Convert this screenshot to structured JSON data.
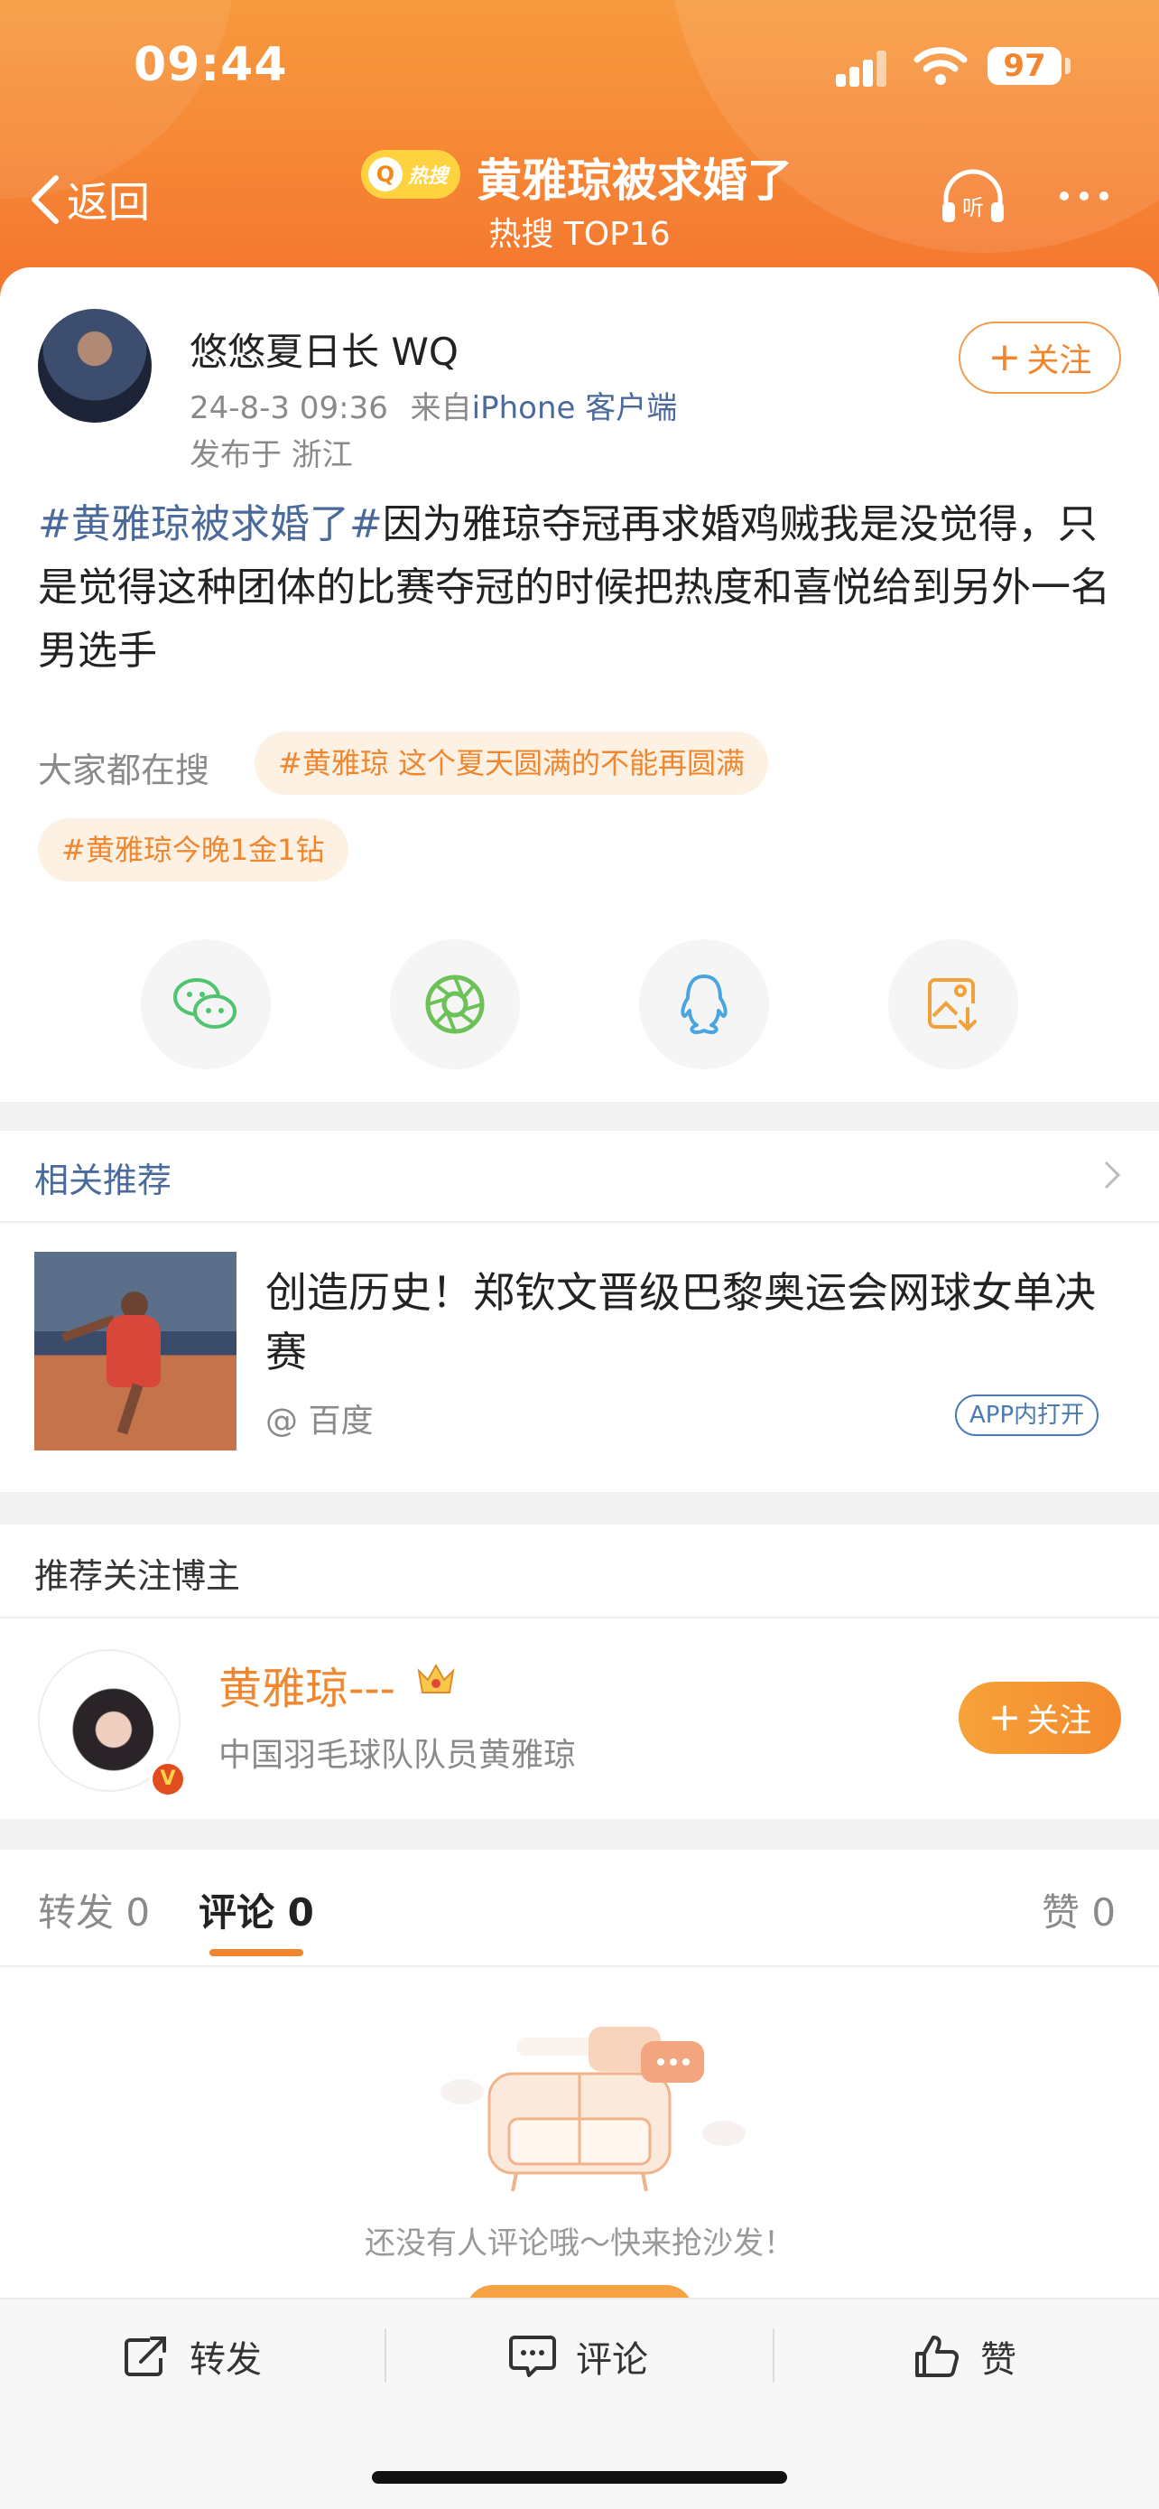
{
  "status_bar": {
    "time": "09:44",
    "battery": "97"
  },
  "nav": {
    "back_label": "返回",
    "hot_badge": "热搜",
    "title": "黄雅琼被求婚了",
    "subtitle": "热搜 TOP16"
  },
  "post": {
    "author": "悠悠夏日长 WQ",
    "date": "24-8-3 09:36",
    "source_prefix": "来自",
    "source": "iPhone 客户端",
    "location": "发布于 浙江",
    "follow_label": "关注",
    "tag": "#黄雅琼被求婚了#",
    "text": "因为雅琼夺冠再求婚鸡贼我是没觉得，只是觉得这种团体的比赛夺冠的时候把热度和喜悦给到另外一名男选手"
  },
  "searches": {
    "label": "大家都在搜",
    "chips": [
      "#黄雅琼 这个夏天圆满的不能再圆满",
      "#黄雅琼今晚1金1钻"
    ]
  },
  "share_icons": [
    "wechat-icon",
    "moments-icon",
    "qq-icon",
    "save-image-icon"
  ],
  "related": {
    "header": "相关推荐",
    "title": "创造历史！郑钦文晋级巴黎奥运会网球女单决赛",
    "source": "@ 百度",
    "app_label": "APP内打开"
  },
  "recommend": {
    "header": "推荐关注博主",
    "name": "黄雅琼---",
    "desc": "中国羽毛球队队员黄雅琼",
    "follow_label": "关注"
  },
  "tabs": {
    "repost": "转发 0",
    "comment": "评论 0",
    "like": "赞 0"
  },
  "empty_text": "还没有人评论哦～快来抢沙发！",
  "bottom_bar": {
    "repost": "转发",
    "comment": "评论",
    "like": "赞"
  },
  "colors": {
    "accent": "#f0862e",
    "link": "#4a6a9c",
    "header_top": "#f79a3e",
    "header_bottom": "#f4752e"
  }
}
